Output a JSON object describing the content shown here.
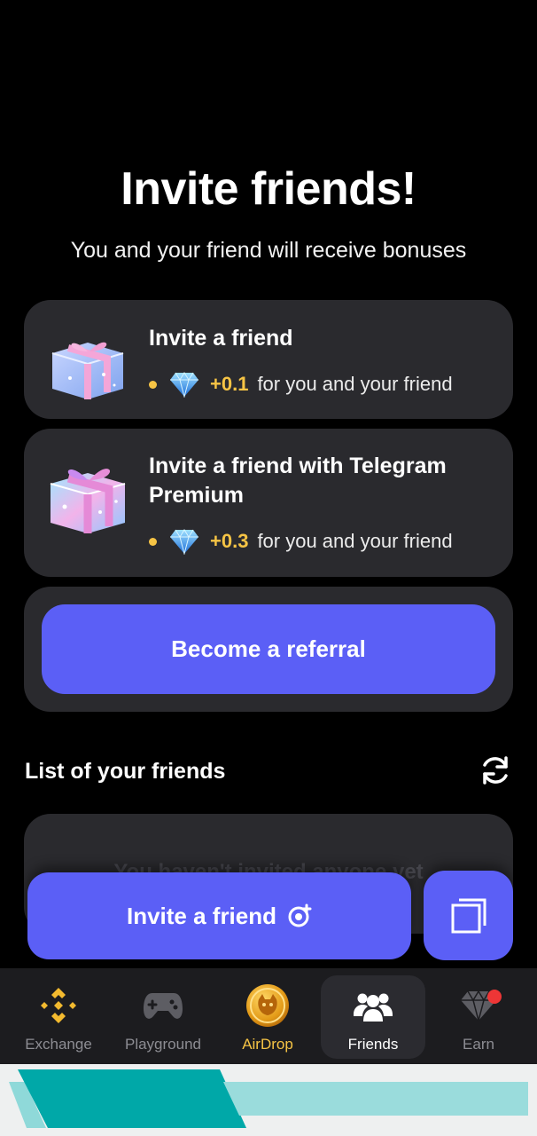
{
  "header": {
    "title": "Invite friends!",
    "subtitle": "You and your friend will receive bonuses"
  },
  "offers": [
    {
      "title": "Invite a friend",
      "amount": "+0.1",
      "text": "for you and your friend",
      "icon": "gift-icon"
    },
    {
      "title": "Invite a friend with Telegram Premium",
      "amount": "+0.3",
      "text": "for you and your friend",
      "icon": "gift-icon"
    }
  ],
  "referral": {
    "button_label": "Become a referral"
  },
  "friends": {
    "header": "List of your friends",
    "empty_text": "You haven't invited anyone yet"
  },
  "invite": {
    "button_label": "Invite a friend"
  },
  "nav": {
    "items": [
      {
        "label": "Exchange",
        "icon": "binance-icon"
      },
      {
        "label": "Playground",
        "icon": "gamepad-icon"
      },
      {
        "label": "AirDrop",
        "icon": "coin-icon"
      },
      {
        "label": "Friends",
        "icon": "friends-icon"
      },
      {
        "label": "Earn",
        "icon": "diamond-icon"
      }
    ],
    "active": "Friends"
  },
  "colors": {
    "accent": "#5b5ff6",
    "gold": "#f6c445",
    "card": "#2a2a2e",
    "notification": "#ee3636"
  }
}
